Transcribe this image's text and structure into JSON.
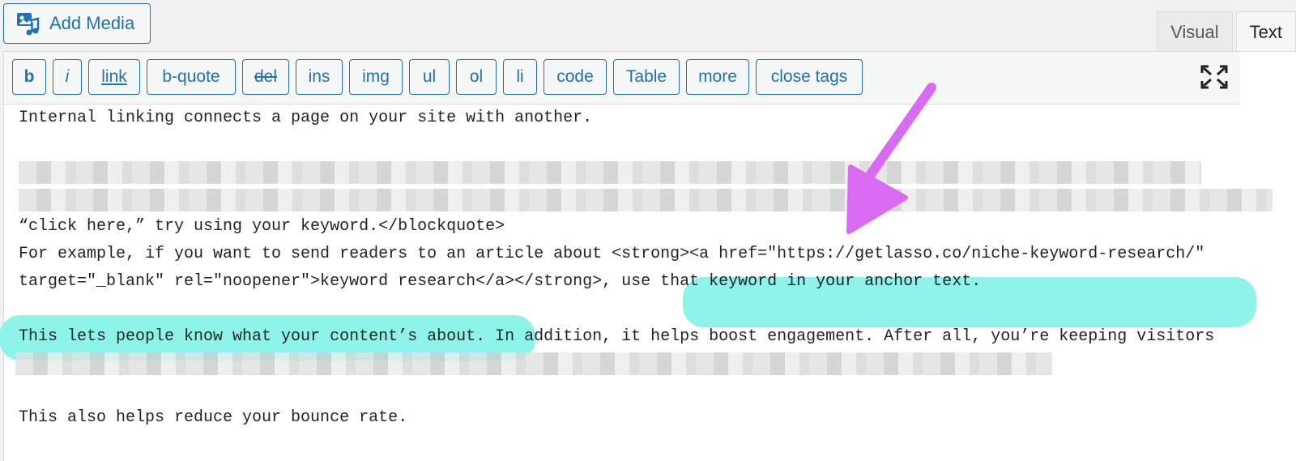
{
  "header": {
    "add_media_label": "Add Media",
    "tabs": [
      {
        "label": "Visual",
        "active": false
      },
      {
        "label": "Text",
        "active": true
      }
    ]
  },
  "toolbar": {
    "buttons": [
      "b",
      "i",
      "link",
      "b-quote",
      "del",
      "ins",
      "img",
      "ul",
      "ol",
      "li",
      "code",
      "Table",
      "more",
      "close tags"
    ]
  },
  "content": {
    "line1": "Internal linking connects a page on your site with another.",
    "line4": "“click here,” try using your keyword.</blockquote>",
    "line5": "For example, if you want to send readers to an article about <strong><a href=\"https://getlasso.co/niche-keyword-research/\"",
    "line6": "target=\"_blank\" rel=\"noopener\">keyword research</a></strong>, use that keyword in your anchor text.",
    "line8": "This lets people know what your content’s about. In addition, it helps boost engagement. After all, you’re keeping visitors",
    "line11": "This also helps reduce your bounce rate."
  },
  "colors": {
    "accent": "#2271b1",
    "highlight": "#8ef4ea",
    "arrow": "#d96af2"
  }
}
